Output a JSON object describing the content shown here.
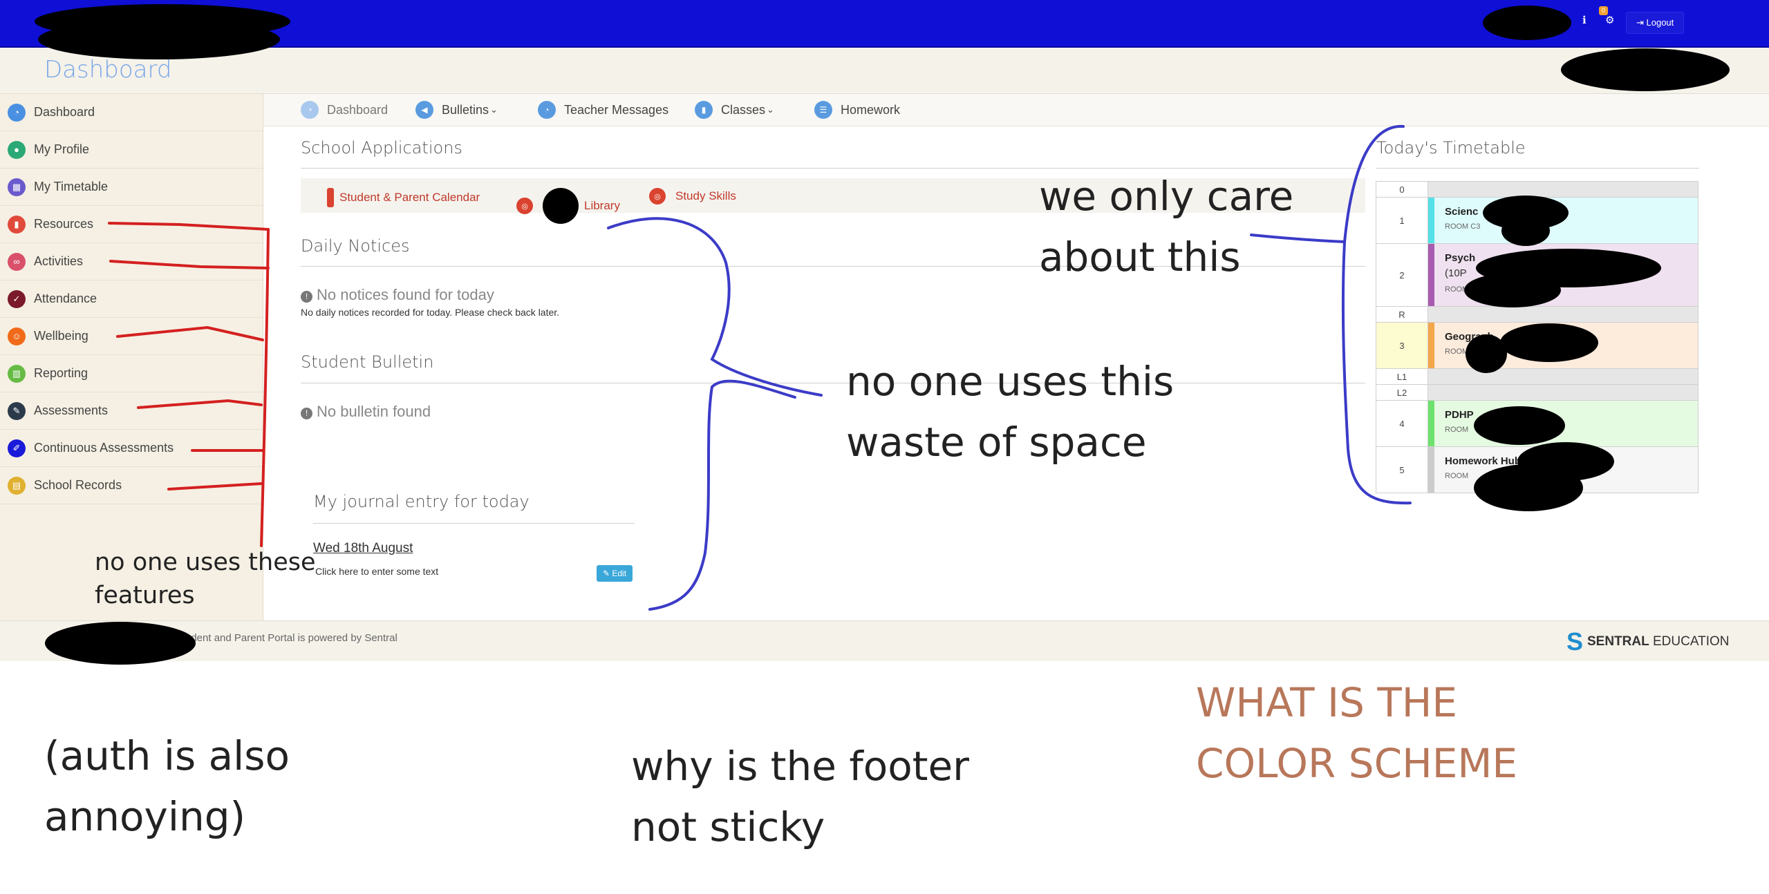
{
  "topbar": {
    "notification_count": "0",
    "logout_label": "Logout",
    "info_icon": "info-icon",
    "settings_icon": "gear-icon"
  },
  "header": {
    "title": "Dashboard"
  },
  "sidebar": {
    "items": [
      {
        "label": "Dashboard",
        "icon": "dashboard-icon",
        "color": "#4a90e2"
      },
      {
        "label": "My Profile",
        "icon": "user-icon",
        "color": "#2aa876"
      },
      {
        "label": "My Timetable",
        "icon": "calendar-icon",
        "color": "#6a5acd"
      },
      {
        "label": "Resources",
        "icon": "book-icon",
        "color": "#e04a3a"
      },
      {
        "label": "Activities",
        "icon": "bike-icon",
        "color": "#d9506a"
      },
      {
        "label": "Attendance",
        "icon": "check-circle-icon",
        "color": "#7a1a2a"
      },
      {
        "label": "Wellbeing",
        "icon": "smile-icon",
        "color": "#f06a1a"
      },
      {
        "label": "Reporting",
        "icon": "chart-icon",
        "color": "#66bb44"
      },
      {
        "label": "Assessments",
        "icon": "pencil-icon",
        "color": "#2a3a4a"
      },
      {
        "label": "Continuous Assessments",
        "icon": "pen-icon",
        "color": "#1a1ad9"
      },
      {
        "label": "School Records",
        "icon": "folder-icon",
        "color": "#e0b030"
      }
    ]
  },
  "tabs": [
    {
      "label": "Dashboard",
      "icon": "dashboard-icon"
    },
    {
      "label": "Bulletins",
      "icon": "megaphone-icon"
    },
    {
      "label": "Teacher Messages",
      "icon": "dashboard-icon"
    },
    {
      "label": "Classes",
      "icon": "book-icon"
    },
    {
      "label": "Homework",
      "icon": "list-icon"
    }
  ],
  "school_applications": {
    "title": "School Applications",
    "links": [
      "Student & Parent Calendar",
      "Library",
      "Study Skills"
    ]
  },
  "daily_notices": {
    "title": "Daily Notices",
    "empty_title": "No notices found for today",
    "empty_sub": "No daily notices recorded for today. Please check back later."
  },
  "student_bulletin": {
    "title": "Student Bulletin",
    "empty_title": "No bulletin found"
  },
  "journal": {
    "title": "My journal entry for today",
    "date": "Wed 18th August",
    "placeholder": "Click here to enter some text",
    "edit_label": "Edit"
  },
  "timetable": {
    "title": "Today's Timetable",
    "rows": [
      {
        "period": "0",
        "subject": "",
        "room": ""
      },
      {
        "period": "1",
        "subject": "Scienc",
        "room": "ROOM C3",
        "strip": "#55e0e8",
        "bg": "#dffcfd"
      },
      {
        "period": "2",
        "subject": "Psych",
        "extra": "(10P",
        "room": "ROOM",
        "strip": "#a85bb0",
        "bg": "#efe1ef"
      },
      {
        "period": "R",
        "subject": "",
        "room": ""
      },
      {
        "period": "3",
        "subject": "Geograph",
        "room": "ROOM",
        "strip": "#f4a64a",
        "bg": "#fdebdc"
      },
      {
        "period": "L1",
        "subject": "",
        "room": ""
      },
      {
        "period": "L2",
        "subject": "",
        "room": ""
      },
      {
        "period": "4",
        "subject": "PDHP",
        "room": "ROOM",
        "strip": "#6ee26e",
        "bg": "#e4fbe1"
      },
      {
        "period": "5",
        "subject": "Homework Hub",
        "room": "ROOM",
        "strip": "#cccccc",
        "bg": "#f6f6f6"
      }
    ]
  },
  "footer": {
    "text": "udent and Parent Portal is powered by Sentral",
    "brand_bold": "SENTRAL",
    "brand_rest": " EDUCATION"
  },
  "annotations": {
    "care": [
      "we only care",
      "about this"
    ],
    "waste": [
      "no one uses this",
      "waste of space"
    ],
    "features": [
      "no one uses these",
      "features"
    ],
    "auth": [
      "(auth is also",
      "annoying)"
    ],
    "footer": [
      "why is the footer",
      "not sticky"
    ],
    "color": [
      "WHAT IS THE",
      "COLOR SCHEME"
    ]
  }
}
